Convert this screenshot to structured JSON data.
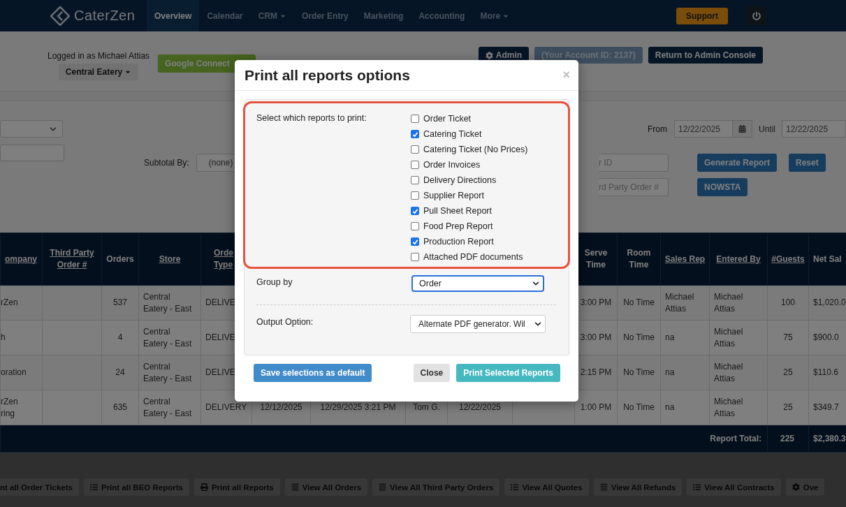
{
  "navbar": {
    "logo": "CaterZen",
    "items": [
      {
        "label": "Overview",
        "selected": true,
        "dropdown": false
      },
      {
        "label": "Calendar",
        "selected": false,
        "dropdown": false
      },
      {
        "label": "CRM",
        "selected": false,
        "dropdown": true
      },
      {
        "label": "Order Entry",
        "selected": false,
        "dropdown": false
      },
      {
        "label": "Marketing",
        "selected": false,
        "dropdown": false
      },
      {
        "label": "Accounting",
        "selected": false,
        "dropdown": false
      },
      {
        "label": "More",
        "selected": false,
        "dropdown": true
      }
    ],
    "support": "Support"
  },
  "account": {
    "logged_in": "Logged in as Michael Attias",
    "store": "Central Eatery",
    "google": "Google Connect",
    "admin": "Admin",
    "account_id": "(Your Account ID: 2137)",
    "return": "Return to Admin Console"
  },
  "filters": {
    "subtotal_label": "Subtotal By:",
    "subtotal_value": "(none)",
    "from_label": "From",
    "from_value": "12/22/2025",
    "until_label": "Until",
    "until_value": "12/22/2025",
    "order_id_placeholder": "r ID",
    "third_party_placeholder": "rd Party Order #",
    "buttons": [
      "Generate Report",
      "Reset",
      "NOWSTA"
    ]
  },
  "table": {
    "columns": [
      {
        "label": "ompany",
        "sortable": true
      },
      {
        "label": "Third Party Order #",
        "sortable": true
      },
      {
        "label": "Orders",
        "sortable": false
      },
      {
        "label": "Store",
        "sortable": true
      },
      {
        "label": "Orde Type",
        "sortable": true
      },
      null,
      null,
      null,
      null,
      null,
      {
        "label": "Serve Time",
        "sortable": false
      },
      {
        "label": "Room Time",
        "sortable": false
      },
      {
        "label": "Sales Rep",
        "sortable": true
      },
      {
        "label": "Entered By",
        "sortable": true
      },
      {
        "label": "#Guests",
        "sortable": true
      },
      {
        "label": "Net Sal",
        "sortable": false
      }
    ],
    "rows": [
      [
        "rZen",
        null,
        "537",
        "Central Eatery - East",
        "DELIVE",
        null,
        null,
        null,
        null,
        null,
        "3:00 PM",
        "No Time",
        "Michael Attias",
        "Michael Attias",
        "100",
        "$1,020.0"
      ],
      [
        "h",
        null,
        "4",
        "Central Eatery - East",
        "DELIVE",
        null,
        null,
        null,
        null,
        null,
        "3:00 PM",
        "No Time",
        "na",
        "Michael Attias",
        "75",
        "$900.0"
      ],
      [
        "oration",
        null,
        "24",
        "Central Eatery - East",
        "DELIVE",
        null,
        null,
        null,
        null,
        null,
        "2:15 PM",
        "No Time",
        "na",
        "Michael Attias",
        "25",
        "$110.6"
      ],
      [
        "rZen ring",
        null,
        "635",
        "Central Eatery - East",
        "DELIVERY",
        "12/12/2025",
        "12/29/2025 3:21 PM",
        "Tom G.",
        "12/22/2025",
        null,
        "1:00 PM",
        "No Time",
        "na",
        "Michael Attias",
        "25",
        "$349.7"
      ]
    ],
    "footer": {
      "label": "Report Total:",
      "guests": "225",
      "net_sales": "$2,380.3"
    }
  },
  "actions": [
    {
      "label": "nt all Order Tickets",
      "kind": "plain"
    },
    {
      "label": "Print all BEO Reports",
      "kind": "list"
    },
    {
      "label": "Print all Reports",
      "kind": "print"
    },
    {
      "label": "View All Orders",
      "kind": "bars"
    },
    {
      "label": "View All Third Party Orders",
      "kind": "bars"
    },
    {
      "label": "View All Quotes",
      "kind": "list"
    },
    {
      "label": "View All Refunds",
      "kind": "bars"
    },
    {
      "label": "View All Contracts",
      "kind": "list"
    },
    {
      "label": "Ove",
      "kind": "gear"
    }
  ],
  "dialog": {
    "title": "Print all reports options",
    "close": "×",
    "reports_label": "Select which reports to print:",
    "highlighted": true,
    "reports": [
      {
        "label": "Order Ticket",
        "checked": false
      },
      {
        "label": "Catering Ticket",
        "checked": true
      },
      {
        "label": "Catering Ticket (No Prices)",
        "checked": false
      },
      {
        "label": "Order Invoices",
        "checked": false
      },
      {
        "label": "Delivery Directions",
        "checked": false
      },
      {
        "label": "Supplier Report",
        "checked": false
      },
      {
        "label": "Pull Sheet Report",
        "checked": true
      },
      {
        "label": "Food Prep Report",
        "checked": false
      },
      {
        "label": "Production Report",
        "checked": true
      },
      {
        "label": "Attached PDF documents",
        "checked": false
      }
    ],
    "group_by": {
      "label": "Group by",
      "value": "Order",
      "focused": true
    },
    "output": {
      "label": "Output Option:",
      "value": "Alternate PDF generator. Wil"
    },
    "buttons": [
      {
        "label": "Save selections as default",
        "kind": "primary"
      },
      {
        "label": "Close",
        "kind": "default"
      },
      {
        "label": "Print Selected Reports",
        "kind": "info"
      }
    ]
  }
}
